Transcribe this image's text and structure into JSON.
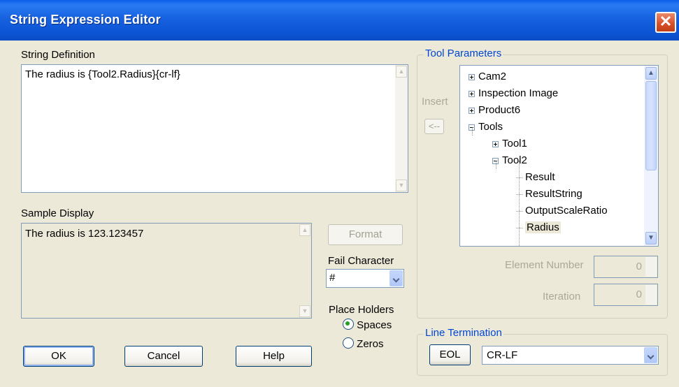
{
  "window": {
    "title": "String Expression Editor",
    "close_symbol": "✕"
  },
  "string_definition": {
    "label": "String Definition",
    "value": "The radius is {Tool2.Radius}{cr-lf}"
  },
  "sample_display": {
    "label": "Sample Display",
    "value": "The radius is 123.123457"
  },
  "tool_parameters": {
    "label": "Tool Parameters",
    "insert_label": "Insert",
    "insert_button": "<--",
    "tree": [
      {
        "label": "Cam2",
        "type": "plus"
      },
      {
        "label": "Inspection Image",
        "type": "plus"
      },
      {
        "label": "Product6",
        "type": "plus"
      },
      {
        "label": "Tools",
        "type": "minus"
      },
      {
        "label": "Tool1",
        "type": "plus"
      },
      {
        "label": "Tool2",
        "type": "minus"
      },
      {
        "label": "Result",
        "type": "leaf"
      },
      {
        "label": "ResultString",
        "type": "leaf"
      },
      {
        "label": "OutputScaleRatio",
        "type": "leaf"
      },
      {
        "label": "Radius",
        "type": "leaf",
        "selected": true
      }
    ],
    "element_number": {
      "label": "Element Number",
      "value": "0"
    },
    "iteration": {
      "label": "Iteration",
      "value": "0"
    }
  },
  "format_button": "Format",
  "fail_character": {
    "label": "Fail Character",
    "value": "#"
  },
  "place_holders": {
    "label": "Place Holders",
    "options": [
      {
        "label": "Spaces",
        "checked": true
      },
      {
        "label": "Zeros",
        "checked": false
      }
    ]
  },
  "line_termination": {
    "label": "Line Termination",
    "eol_button": "EOL",
    "value": "CR-LF"
  },
  "buttons": {
    "ok": "OK",
    "cancel": "Cancel",
    "help": "Help"
  }
}
